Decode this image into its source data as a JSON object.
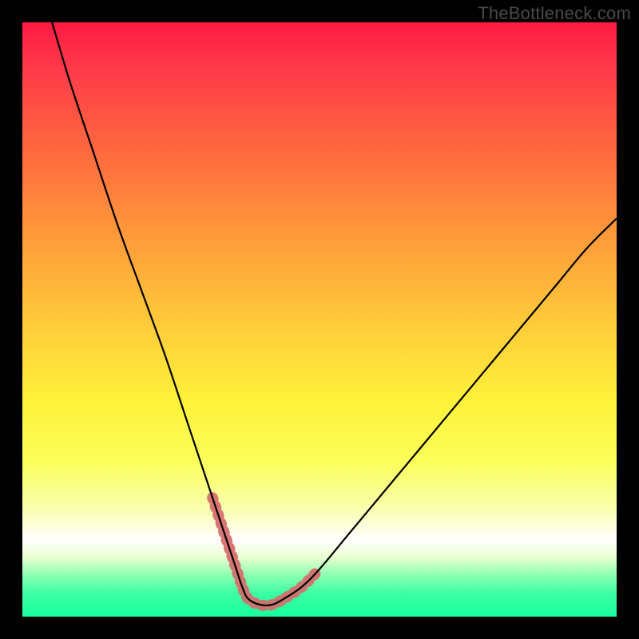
{
  "watermark": "TheBottleneck.com",
  "chart_data": {
    "type": "line",
    "title": "",
    "xlabel": "",
    "ylabel": "",
    "xlim": [
      0,
      100
    ],
    "ylim": [
      0,
      100
    ],
    "grid": false,
    "series": [
      {
        "name": "bottleneck-curve",
        "x": [
          5,
          8,
          12,
          16,
          20,
          24,
          28,
          30,
          32,
          34,
          35,
          36,
          37,
          38,
          40,
          42,
          44,
          47,
          50,
          55,
          60,
          65,
          70,
          75,
          80,
          85,
          90,
          95,
          100
        ],
        "values": [
          100,
          90,
          78,
          66,
          55,
          44,
          32,
          26,
          20,
          14,
          11,
          8,
          5,
          3,
          2,
          2,
          3,
          5,
          8,
          14,
          20,
          26,
          32,
          38,
          44,
          50,
          56,
          62,
          67
        ]
      }
    ],
    "tolerance_band": {
      "name": "acceptable-range",
      "x": [
        32,
        34,
        35,
        36,
        37,
        38,
        40,
        42,
        44,
        47,
        50
      ],
      "values": [
        20,
        14,
        11,
        8,
        5,
        3,
        2,
        2,
        3,
        5,
        8
      ]
    },
    "gradient_stops": [
      {
        "pos": 0.0,
        "color": "#ff1a44"
      },
      {
        "pos": 0.5,
        "color": "#fff23a"
      },
      {
        "pos": 0.87,
        "color": "#ffffff"
      },
      {
        "pos": 1.0,
        "color": "#19ff9e"
      }
    ]
  }
}
